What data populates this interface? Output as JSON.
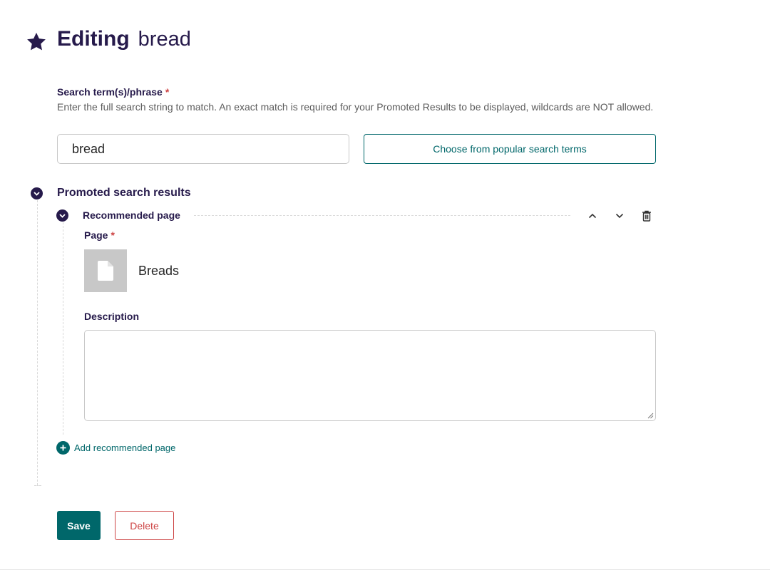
{
  "header": {
    "title_action": "Editing",
    "title_subject": "bread",
    "icon": "star-icon"
  },
  "search_term": {
    "label": "Search term(s)/phrase",
    "required_marker": "*",
    "help_text": "Enter the full search string to match. An exact match is required for your Promoted Results to be displayed, wildcards are NOT allowed.",
    "value": "bread",
    "choose_button_label": "Choose from popular search terms"
  },
  "promoted_results": {
    "section_title": "Promoted search results",
    "block": {
      "title": "Recommended page",
      "page_label": "Page",
      "page_required_marker": "*",
      "page_title": "Breads",
      "description_label": "Description",
      "description_value": ""
    },
    "add_label": "Add recommended page"
  },
  "actions": {
    "save_label": "Save",
    "delete_label": "Delete"
  },
  "colors": {
    "primary": "#261a4b",
    "teal": "#00676a",
    "danger": "#cd4444"
  }
}
